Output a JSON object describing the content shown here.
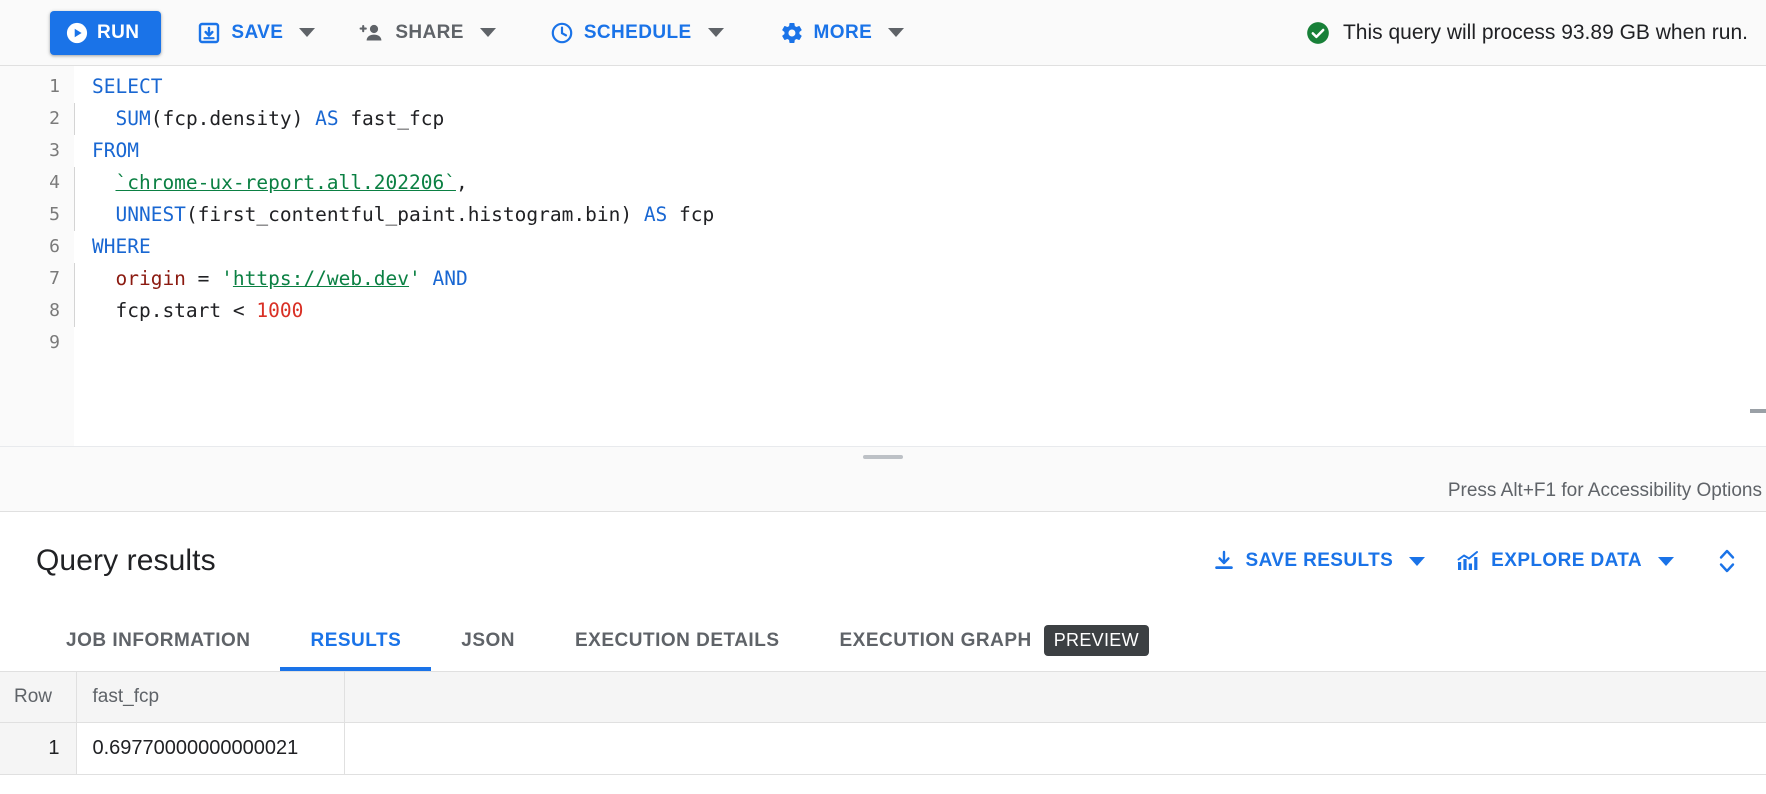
{
  "toolbar": {
    "run_label": "RUN",
    "save_label": "SAVE",
    "share_label": "SHARE",
    "schedule_label": "SCHEDULE",
    "more_label": "MORE",
    "validator_text": "This query will process 93.89 GB when run.",
    "validator_color": "#188038",
    "accent_color": "#1a73e8"
  },
  "editor": {
    "line_numbers": [
      "1",
      "2",
      "3",
      "4",
      "5",
      "6",
      "7",
      "8",
      "9"
    ],
    "lines": [
      {
        "n": "1",
        "tokens": [
          {
            "t": "SELECT",
            "c": "kw"
          }
        ]
      },
      {
        "n": "2",
        "tokens": [
          {
            "t": "  ",
            "c": "punc"
          },
          {
            "t": "SUM",
            "c": "fn"
          },
          {
            "t": "(fcp.density) ",
            "c": "id"
          },
          {
            "t": "AS",
            "c": "kw"
          },
          {
            "t": " fast_fcp",
            "c": "id"
          }
        ]
      },
      {
        "n": "3",
        "tokens": [
          {
            "t": "FROM",
            "c": "kw"
          }
        ]
      },
      {
        "n": "4",
        "tokens": [
          {
            "t": "  ",
            "c": "punc"
          },
          {
            "t": "`chrome-ux-report.all.202206`",
            "c": "lnk"
          },
          {
            "t": ",",
            "c": "punc"
          }
        ]
      },
      {
        "n": "5",
        "tokens": [
          {
            "t": "  ",
            "c": "punc"
          },
          {
            "t": "UNNEST",
            "c": "fn"
          },
          {
            "t": "(first_contentful_paint.histogram.bin) ",
            "c": "id"
          },
          {
            "t": "AS",
            "c": "kw"
          },
          {
            "t": " fcp",
            "c": "id"
          }
        ]
      },
      {
        "n": "6",
        "tokens": [
          {
            "t": "WHERE",
            "c": "kw"
          }
        ]
      },
      {
        "n": "7",
        "tokens": [
          {
            "t": "  ",
            "c": "punc"
          },
          {
            "t": "origin",
            "c": "col"
          },
          {
            "t": " = ",
            "c": "punc"
          },
          {
            "t": "'",
            "c": "str"
          },
          {
            "t": "https://web.dev",
            "c": "lnk"
          },
          {
            "t": "'",
            "c": "str"
          },
          {
            "t": " ",
            "c": "punc"
          },
          {
            "t": "AND",
            "c": "kw"
          }
        ]
      },
      {
        "n": "8",
        "tokens": [
          {
            "t": "  ",
            "c": "punc"
          },
          {
            "t": "fcp.start ",
            "c": "id"
          },
          {
            "t": "<",
            "c": "punc"
          },
          {
            "t": " ",
            "c": "punc"
          },
          {
            "t": "1000",
            "c": "num"
          }
        ]
      },
      {
        "n": "9",
        "tokens": []
      }
    ],
    "accessibility_hint": "Press Alt+F1 for Accessibility Options"
  },
  "results": {
    "title": "Query results",
    "save_results_label": "SAVE RESULTS",
    "explore_data_label": "EXPLORE DATA",
    "tabs": [
      {
        "label": "JOB INFORMATION",
        "active": false,
        "badge": null
      },
      {
        "label": "RESULTS",
        "active": true,
        "badge": null
      },
      {
        "label": "JSON",
        "active": false,
        "badge": null
      },
      {
        "label": "EXECUTION DETAILS",
        "active": false,
        "badge": null
      },
      {
        "label": "EXECUTION GRAPH",
        "active": false,
        "badge": "PREVIEW"
      }
    ],
    "table": {
      "columns": [
        "Row",
        "fast_fcp",
        ""
      ],
      "rows": [
        [
          "1",
          "0.69770000000000021",
          ""
        ]
      ]
    }
  }
}
